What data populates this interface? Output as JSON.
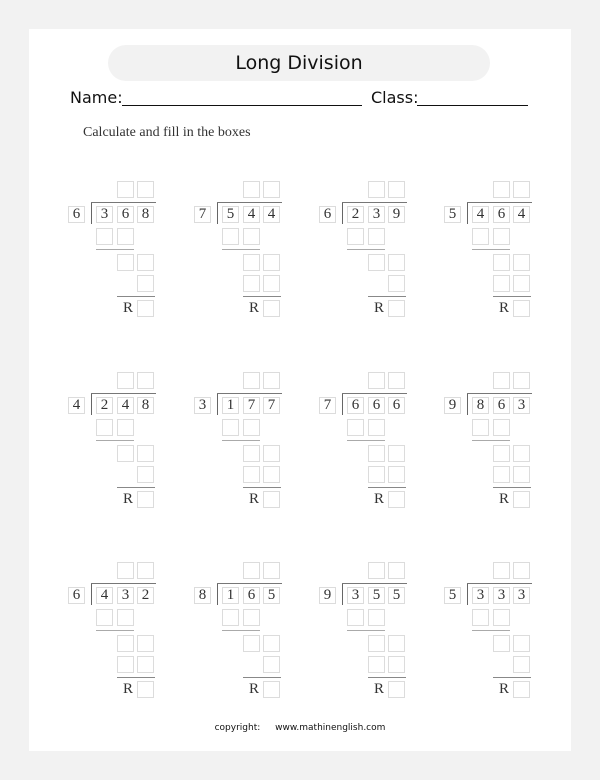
{
  "title": "Long Division",
  "name_label": "Name:",
  "class_label": "Class:",
  "instructions": "Calculate and fill in the boxes",
  "remainder_label": "R",
  "problems": [
    {
      "divisor": "6",
      "dividend": [
        "3",
        "6",
        "8"
      ],
      "third_row_boxes": 1
    },
    {
      "divisor": "7",
      "dividend": [
        "5",
        "4",
        "4"
      ],
      "third_row_boxes": 2
    },
    {
      "divisor": "6",
      "dividend": [
        "2",
        "3",
        "9"
      ],
      "third_row_boxes": 1
    },
    {
      "divisor": "5",
      "dividend": [
        "4",
        "6",
        "4"
      ],
      "third_row_boxes": 2
    },
    {
      "divisor": "4",
      "dividend": [
        "2",
        "4",
        "8"
      ],
      "third_row_boxes": 1
    },
    {
      "divisor": "3",
      "dividend": [
        "1",
        "7",
        "7"
      ],
      "third_row_boxes": 2
    },
    {
      "divisor": "7",
      "dividend": [
        "6",
        "6",
        "6"
      ],
      "third_row_boxes": 2
    },
    {
      "divisor": "9",
      "dividend": [
        "8",
        "6",
        "3"
      ],
      "third_row_boxes": 2
    },
    {
      "divisor": "6",
      "dividend": [
        "4",
        "3",
        "2"
      ],
      "third_row_boxes": 2
    },
    {
      "divisor": "8",
      "dividend": [
        "1",
        "6",
        "5"
      ],
      "third_row_boxes": 1
    },
    {
      "divisor": "9",
      "dividend": [
        "3",
        "5",
        "5"
      ],
      "third_row_boxes": 2
    },
    {
      "divisor": "5",
      "dividend": [
        "3",
        "3",
        "3"
      ],
      "third_row_boxes": 1
    }
  ],
  "footer": {
    "copyright_label": "copyright:",
    "website": "www.mathinenglish.com"
  }
}
